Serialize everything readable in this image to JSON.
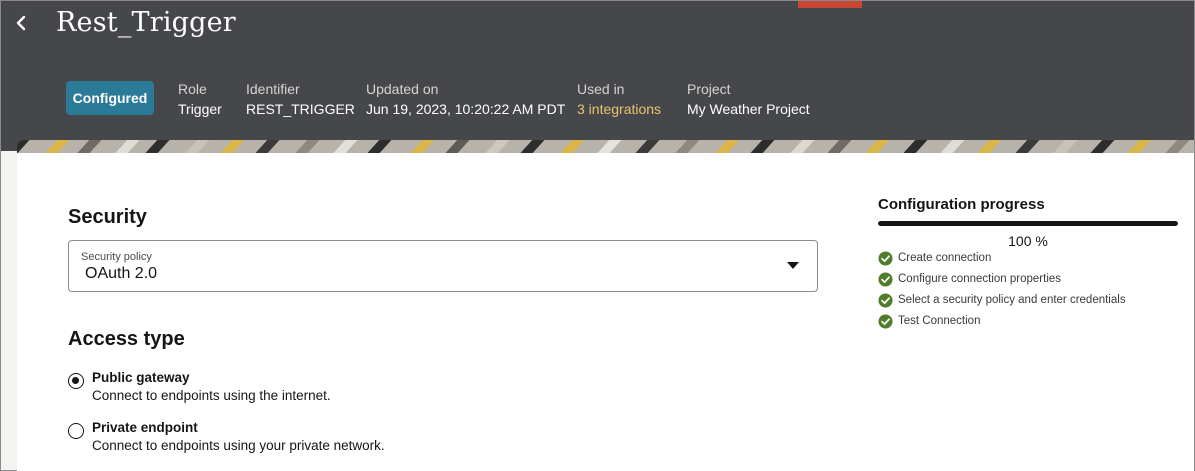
{
  "header": {
    "title": "Rest_Trigger",
    "status": "Configured",
    "meta": [
      {
        "label": "Role",
        "value": "Trigger"
      },
      {
        "label": "Identifier",
        "value": "REST_TRIGGER"
      },
      {
        "label": "Updated on",
        "value": "Jun 19, 2023, 10:20:22 AM PDT"
      },
      {
        "label": "Used in",
        "value": "3 integrations"
      },
      {
        "label": "Project",
        "value": "My Weather Project"
      }
    ]
  },
  "security": {
    "heading": "Security",
    "policy_label": "Security policy",
    "policy_value": "OAuth 2.0"
  },
  "access": {
    "heading": "Access type",
    "options": [
      {
        "title": "Public gateway",
        "desc": "Connect to endpoints using the internet.",
        "checked": true
      },
      {
        "title": "Private endpoint",
        "desc": "Connect to endpoints using your private network.",
        "checked": false
      }
    ]
  },
  "progress": {
    "heading": "Configuration progress",
    "percent_text": "100 %",
    "fraction": 1.0,
    "steps": [
      "Create connection",
      "Configure connection properties",
      "Select a security policy and enter credentials",
      "Test Connection"
    ]
  },
  "colors": {
    "header_bg": "#45474b",
    "badge_bg": "#2b7a98",
    "link": "#e8c46f",
    "accent": "#c74634",
    "check_green": "#4f7d2b"
  },
  "icons": {
    "back": "chevron-left-icon",
    "dropdown": "caret-down-icon",
    "step_done": "check-circle-icon"
  }
}
